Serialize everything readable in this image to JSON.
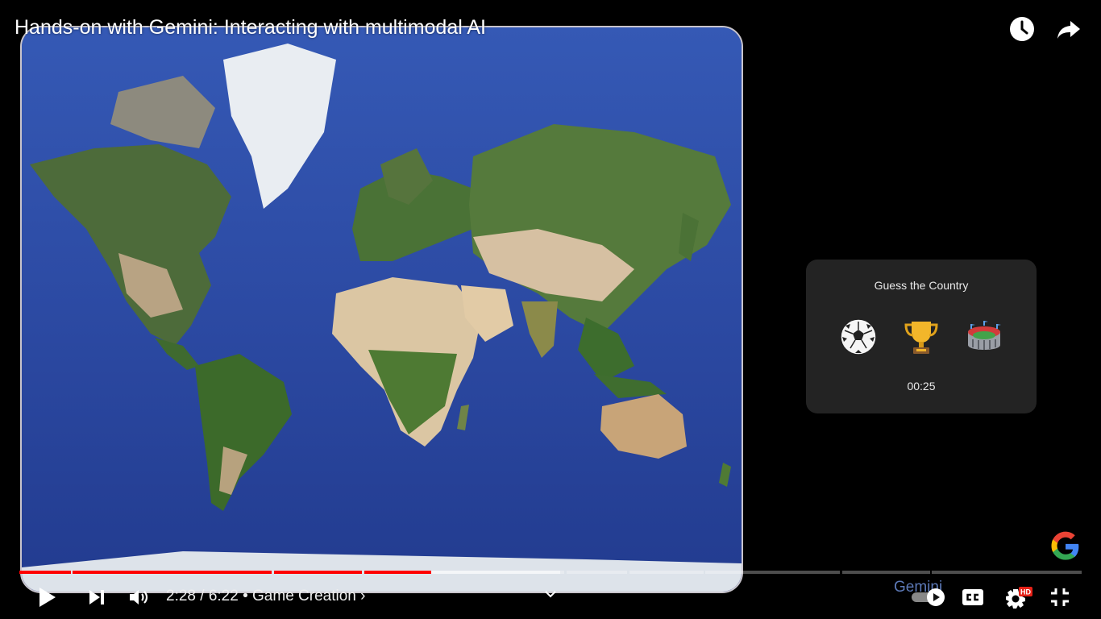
{
  "video": {
    "title": "Hands-on with Gemini: Interacting with multimodal AI",
    "current_time": "2:28",
    "duration": "6:22",
    "time_separator": "/",
    "chapter_bullet": "•",
    "chapter": "Game Creation",
    "chapter_chevron": "›",
    "progress_fraction": 0.388,
    "hd_badge": "HD",
    "overlay_brand_text": "Gemini"
  },
  "game": {
    "title": "Guess the Country",
    "emojis": [
      "soccer-ball",
      "trophy",
      "stadium"
    ],
    "timer": "00:25"
  },
  "icons": {
    "watch_later": "clock-icon",
    "share": "share-arrow-icon",
    "play": "play-icon",
    "next": "next-icon",
    "volume": "volume-icon",
    "chapters_dropdown": "chevron-down-icon",
    "autoplay": "autoplay-toggle-icon",
    "captions": "cc-icon",
    "settings": "gear-icon",
    "exit_fullscreen": "exit-fullscreen-icon"
  },
  "colors": {
    "progress_played": "#ff0000",
    "background": "#000000",
    "card": "#232323",
    "ocean": "#2f4da0"
  }
}
